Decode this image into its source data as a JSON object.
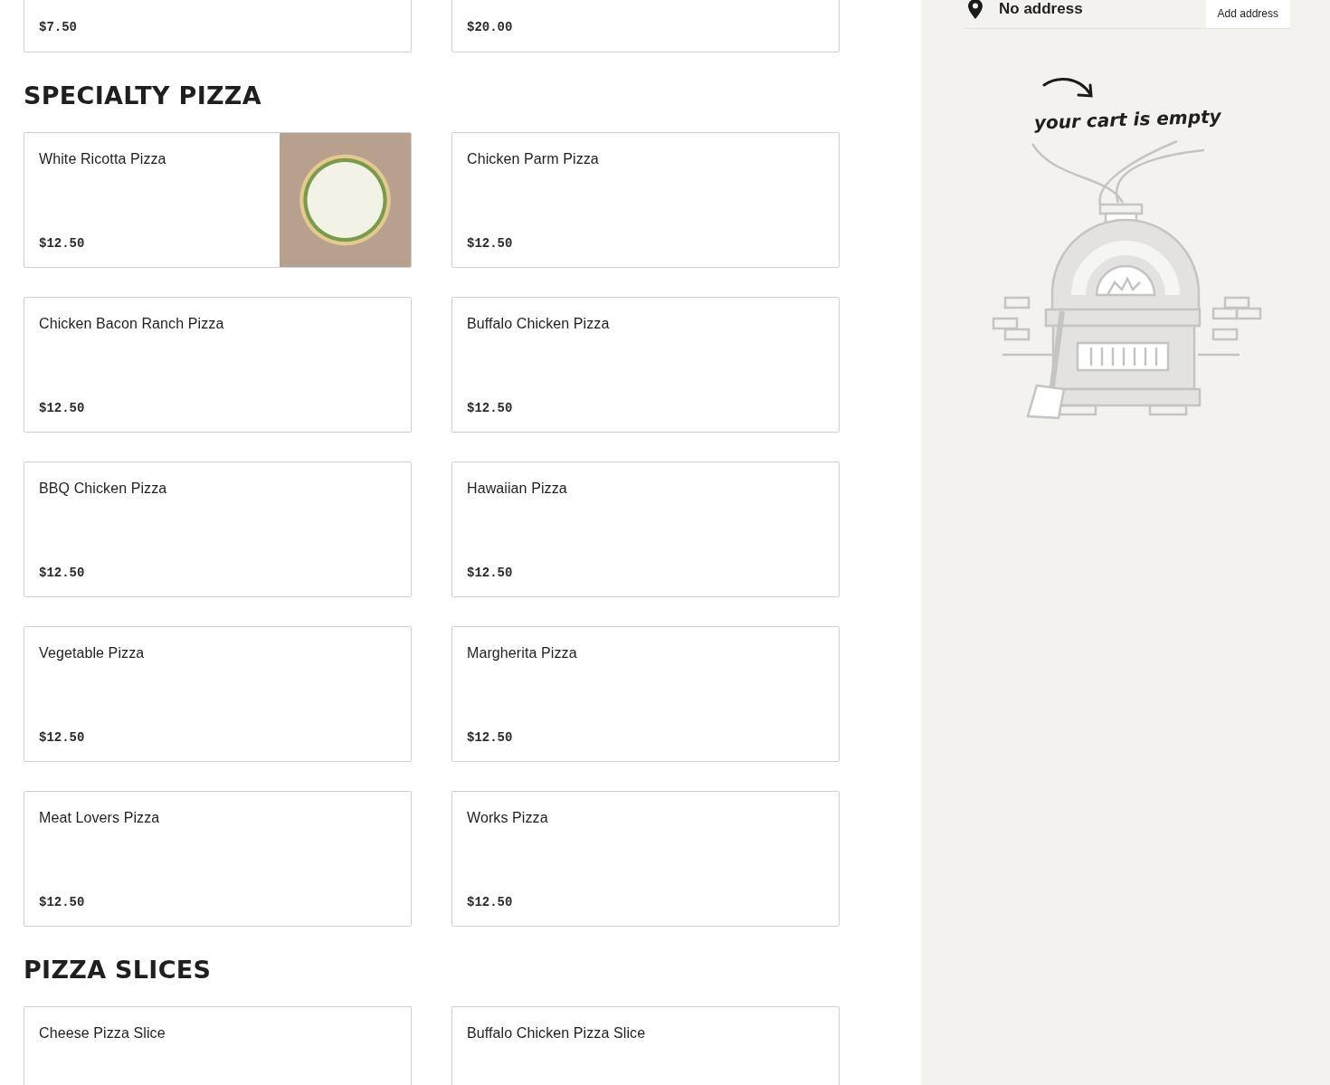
{
  "top_items": [
    {
      "price": "$7.50"
    },
    {
      "price": "$20.00"
    }
  ],
  "sections": [
    {
      "title": "SPECIALTY PIZZA",
      "items": [
        {
          "name": "White Ricotta Pizza",
          "price": "$12.50",
          "kind": "photo"
        },
        {
          "name": "Chicken Parm Pizza",
          "price": "$12.50",
          "kind": "plain"
        },
        {
          "name": "Chicken Bacon Ranch Pizza",
          "price": "$12.50",
          "kind": "plain"
        },
        {
          "name": "Buffalo Chicken Pizza",
          "price": "$12.50",
          "kind": "plain"
        },
        {
          "name": "BBQ Chicken Pizza",
          "price": "$12.50",
          "kind": "plain"
        },
        {
          "name": "Hawaiian Pizza",
          "price": "$12.50",
          "kind": "plain"
        },
        {
          "name": "Vegetable Pizza",
          "price": "$12.50",
          "kind": "plain"
        },
        {
          "name": "Margherita Pizza",
          "price": "$12.50",
          "kind": "plain"
        },
        {
          "name": "Meat Lovers Pizza",
          "price": "$12.50",
          "kind": "plain"
        },
        {
          "name": "Works Pizza",
          "price": "$12.50",
          "kind": "plain"
        }
      ]
    },
    {
      "title": "PIZZA SLICES",
      "items": [
        {
          "name": "Cheese Pizza Slice",
          "kind": "plain"
        },
        {
          "name": "Buffalo Chicken Pizza Slice",
          "kind": "plain"
        }
      ]
    }
  ],
  "cart": {
    "address": "No address",
    "add_address_button": "Add address",
    "empty_message": "your cart is empty"
  }
}
